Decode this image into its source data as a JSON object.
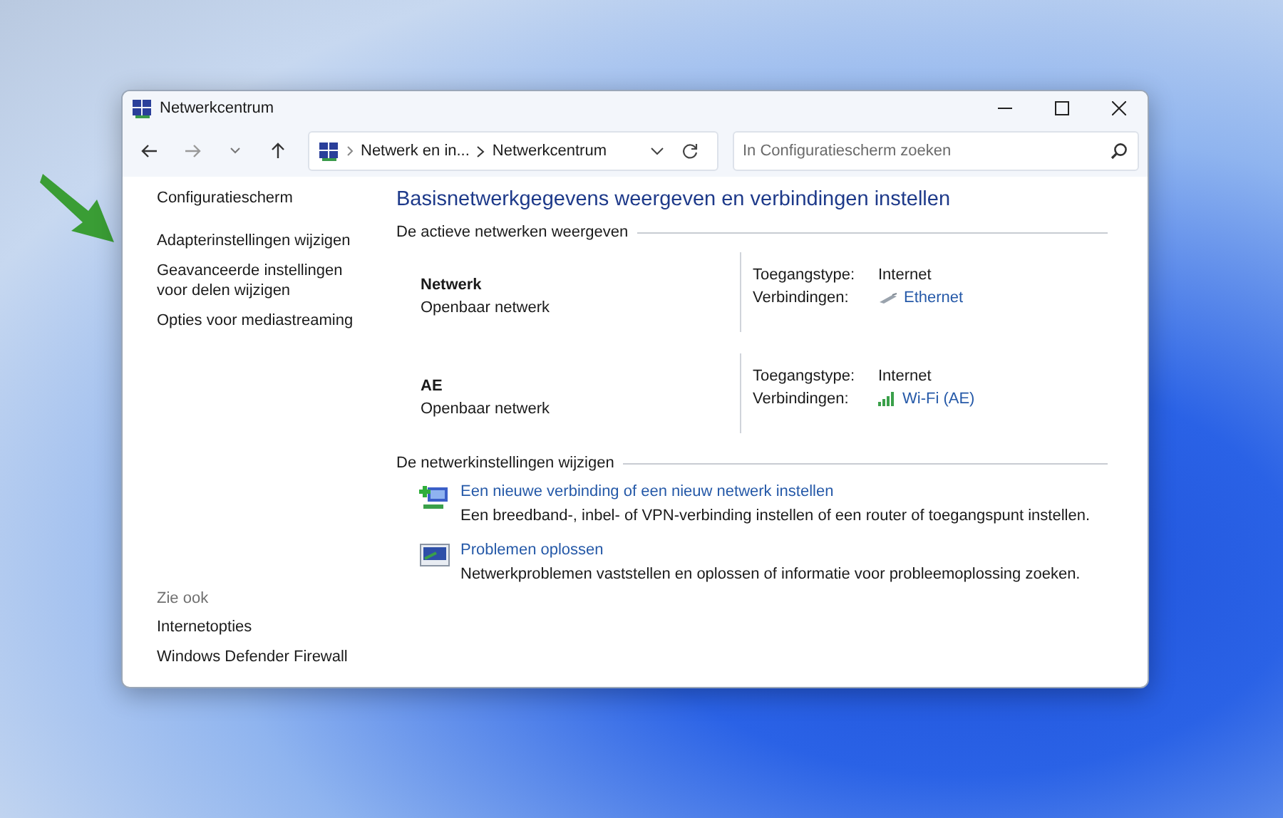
{
  "window": {
    "title": "Netwerkcentrum"
  },
  "address_bar": {
    "breadcrumbs": [
      "Netwerk en in...",
      "Netwerkcentrum"
    ]
  },
  "search": {
    "placeholder": "In Configuratiescherm zoeken"
  },
  "sidebar": {
    "home": "Configuratiescherm",
    "links": [
      "Adapterinstellingen wijzigen",
      "Geavanceerde instellingen voor delen wijzigen",
      "Opties voor mediastreaming"
    ],
    "see_also_heading": "Zie ook",
    "see_also": [
      "Internetopties",
      "Windows Defender Firewall"
    ]
  },
  "heading": "Basisnetwerkgegevens weergeven en verbindingen instellen",
  "active_networks": {
    "heading": "De actieve netwerken weergeven",
    "networks": [
      {
        "name": "Netwerk",
        "category": "Openbaar netwerk",
        "access_label": "Toegangstype:",
        "access_value": "Internet",
        "connections_label": "Verbindingen:",
        "connection": "Ethernet",
        "kind": "ethernet"
      },
      {
        "name": "AE",
        "category": "Openbaar netwerk",
        "access_label": "Toegangstype:",
        "access_value": "Internet",
        "connections_label": "Verbindingen:",
        "connection": "Wi-Fi (AE)",
        "kind": "wifi"
      }
    ]
  },
  "change_settings": {
    "heading": "De netwerkinstellingen wijzigen",
    "tasks": [
      {
        "title": "Een nieuwe verbinding of een nieuw netwerk instellen",
        "description": "Een breedband-, inbel- of VPN-verbinding instellen of een router of toegangspunt instellen.",
        "kind": "new_connection"
      },
      {
        "title": "Problemen oplossen",
        "description": "Netwerkproblemen vaststellen en oplossen of informatie voor probleemoplossing zoeken.",
        "kind": "troubleshoot"
      }
    ]
  }
}
